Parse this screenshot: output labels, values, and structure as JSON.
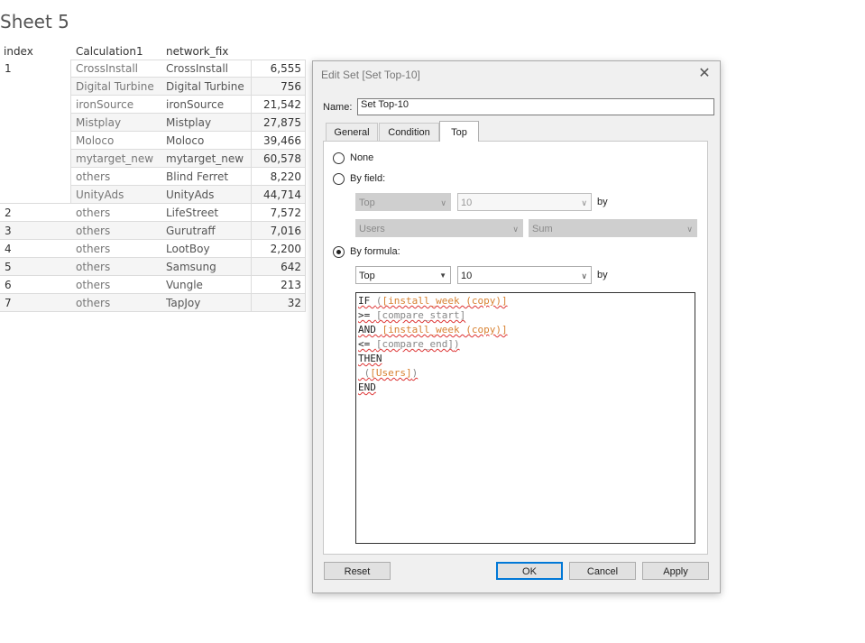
{
  "sheet": {
    "title": "Sheet 5",
    "headers": [
      "index",
      "Calculation1",
      "network_fix"
    ],
    "rows": [
      {
        "index": "1",
        "calc": "CrossInstall",
        "network": "CrossInstall",
        "value": "6,555"
      },
      {
        "index": "",
        "calc": "Digital Turbine",
        "network": "Digital Turbine",
        "value": "756"
      },
      {
        "index": "",
        "calc": "ironSource",
        "network": "ironSource",
        "value": "21,542"
      },
      {
        "index": "",
        "calc": "Mistplay",
        "network": "Mistplay",
        "value": "27,875"
      },
      {
        "index": "",
        "calc": "Moloco",
        "network": "Moloco",
        "value": "39,466"
      },
      {
        "index": "",
        "calc": "mytarget_new",
        "network": "mytarget_new",
        "value": "60,578"
      },
      {
        "index": "",
        "calc": "others",
        "network": "Blind Ferret",
        "value": "8,220"
      },
      {
        "index": "",
        "calc": "UnityAds",
        "network": "UnityAds",
        "value": "44,714"
      },
      {
        "index": "2",
        "calc": "others",
        "network": "LifeStreet",
        "value": "7,572"
      },
      {
        "index": "3",
        "calc": "others",
        "network": "Gurutraff",
        "value": "7,016"
      },
      {
        "index": "4",
        "calc": "others",
        "network": "LootBoy",
        "value": "2,200"
      },
      {
        "index": "5",
        "calc": "others",
        "network": "Samsung",
        "value": "642"
      },
      {
        "index": "6",
        "calc": "others",
        "network": "Vungle",
        "value": "213"
      },
      {
        "index": "7",
        "calc": "others",
        "network": "TapJoy",
        "value": "32"
      }
    ]
  },
  "dialog": {
    "title": "Edit Set [Set Top-10]",
    "close_glyph": "✕",
    "name_label": "Name:",
    "name_value": "Set Top-10",
    "tabs": [
      "General",
      "Condition",
      "Top"
    ],
    "active_tab": "Top",
    "options": {
      "none": "None",
      "by_field": "By field:",
      "by_formula": "By formula:"
    },
    "selected_option": "by_formula",
    "by_field": {
      "direction": "Top",
      "count": "10",
      "by_label": "by",
      "field": "Users",
      "aggregation": "Sum"
    },
    "by_formula": {
      "direction": "Top",
      "count": "10",
      "by_label": "by",
      "formula_lines": [
        [
          {
            "t": "IF ",
            "c": "kw"
          },
          {
            "t": "(",
            "c": "par"
          },
          {
            "t": "[install_week (copy)]",
            "c": "fld"
          }
        ],
        [
          {
            "t": ">= ",
            "c": "op"
          },
          {
            "t": "[compare_start]",
            "c": "par"
          }
        ],
        [
          {
            "t": "AND ",
            "c": "kw"
          },
          {
            "t": "[install_week (copy)]",
            "c": "fld"
          }
        ],
        [
          {
            "t": "<= ",
            "c": "op"
          },
          {
            "t": "[compare_end]",
            "c": "par"
          },
          {
            "t": ")",
            "c": "par"
          }
        ],
        [
          {
            "t": "THEN",
            "c": "kw"
          }
        ],
        [
          {
            "t": " (",
            "c": "par"
          },
          {
            "t": "[Users]",
            "c": "fld"
          },
          {
            "t": ")",
            "c": "par"
          }
        ],
        [
          {
            "t": "END",
            "c": "kw"
          }
        ]
      ]
    },
    "buttons": {
      "reset": "Reset",
      "ok": "OK",
      "cancel": "Cancel",
      "apply": "Apply"
    },
    "icons": {
      "dropdown": "chevron-down-icon",
      "close": "close-icon"
    }
  }
}
